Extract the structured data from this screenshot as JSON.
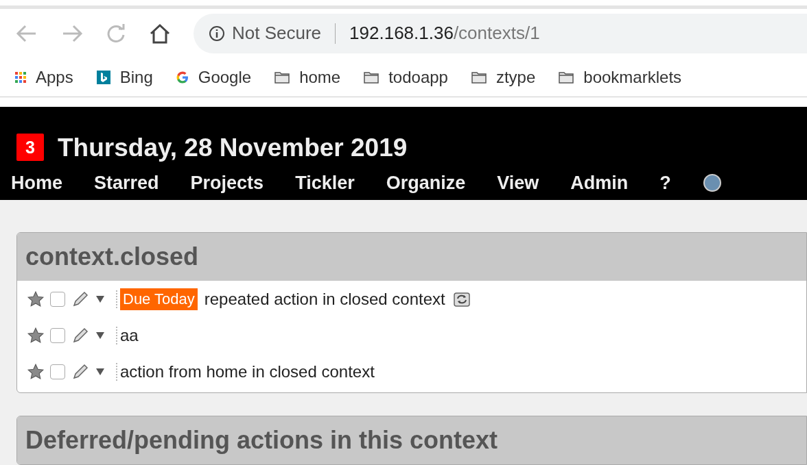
{
  "address": {
    "security": "Not Secure",
    "host": "192.168.1.36",
    "path": "/contexts/1"
  },
  "bookmarks": [
    {
      "label": "Apps",
      "kind": "apps"
    },
    {
      "label": "Bing",
      "kind": "bing"
    },
    {
      "label": "Google",
      "kind": "google"
    },
    {
      "label": "home",
      "kind": "folder"
    },
    {
      "label": "todoapp",
      "kind": "folder"
    },
    {
      "label": "ztype",
      "kind": "folder"
    },
    {
      "label": "bookmarklets",
      "kind": "folder"
    }
  ],
  "header": {
    "badge": "3",
    "date": "Thursday, 28 November 2019"
  },
  "menu": [
    {
      "label": "Home"
    },
    {
      "label": "Starred"
    },
    {
      "label": "Projects"
    },
    {
      "label": "Tickler"
    },
    {
      "label": "Organize"
    },
    {
      "label": "View"
    },
    {
      "label": "Admin"
    },
    {
      "label": "?"
    }
  ],
  "sections": [
    {
      "title": "context.closed",
      "actions": [
        {
          "starred": false,
          "checked": false,
          "due": "Due Today",
          "text": "repeated action in closed context",
          "repeating": true
        },
        {
          "starred": false,
          "checked": false,
          "text": "aa",
          "repeating": false
        },
        {
          "starred": false,
          "checked": false,
          "text": "action from home in closed context",
          "repeating": false
        }
      ]
    },
    {
      "title": "Deferred/pending actions in this context"
    }
  ]
}
